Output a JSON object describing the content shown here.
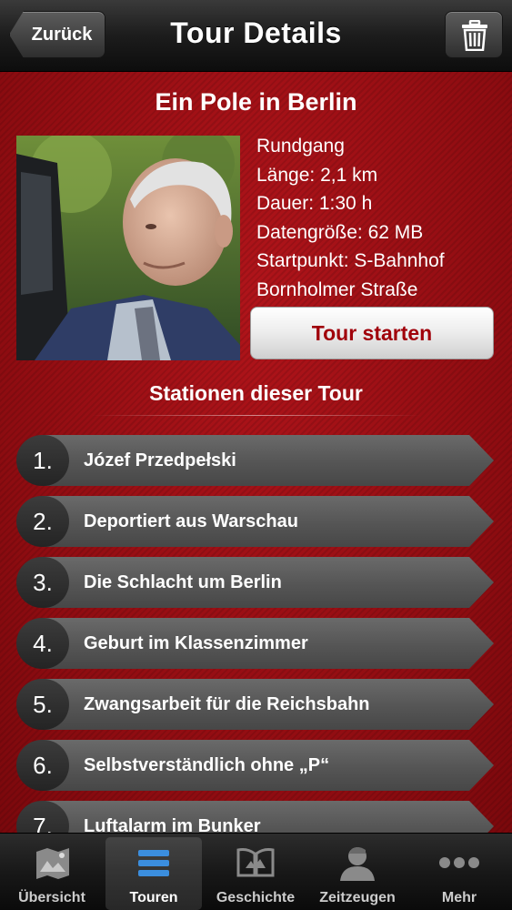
{
  "navbar": {
    "back_label": "Zurück",
    "title": "Tour Details"
  },
  "tour": {
    "title": "Ein Pole in Berlin",
    "type": "Rundgang",
    "length": "Länge: 2,1 km",
    "duration": "Dauer: 1:30 h",
    "data_size": "Datengröße: 62 MB",
    "start_point_line1": "Startpunkt: S-Bahnhof",
    "start_point_line2": "Bornholmer Straße",
    "start_button": "Tour starten"
  },
  "stations": {
    "title": "Stationen dieser Tour",
    "items": [
      {
        "number": "1.",
        "label": "Józef Przedpełski"
      },
      {
        "number": "2.",
        "label": "Deportiert aus Warschau"
      },
      {
        "number": "3.",
        "label": "Die Schlacht um Berlin"
      },
      {
        "number": "4.",
        "label": "Geburt im Klassenzimmer"
      },
      {
        "number": "5.",
        "label": "Zwangsarbeit für die Reichsbahn"
      },
      {
        "number": "6.",
        "label": "Selbstverständlich ohne „P“"
      },
      {
        "number": "7.",
        "label": "Luftalarm im Bunker"
      }
    ]
  },
  "tabbar": {
    "items": [
      {
        "label": "Übersicht",
        "icon": "map-icon"
      },
      {
        "label": "Touren",
        "icon": "list-icon"
      },
      {
        "label": "Geschichte",
        "icon": "book-icon"
      },
      {
        "label": "Zeitzeugen",
        "icon": "person-icon"
      },
      {
        "label": "Mehr",
        "icon": "more-icon"
      }
    ],
    "active": "Touren"
  },
  "colors": {
    "accent": "#a0000a",
    "background": "#8c0a0e"
  }
}
